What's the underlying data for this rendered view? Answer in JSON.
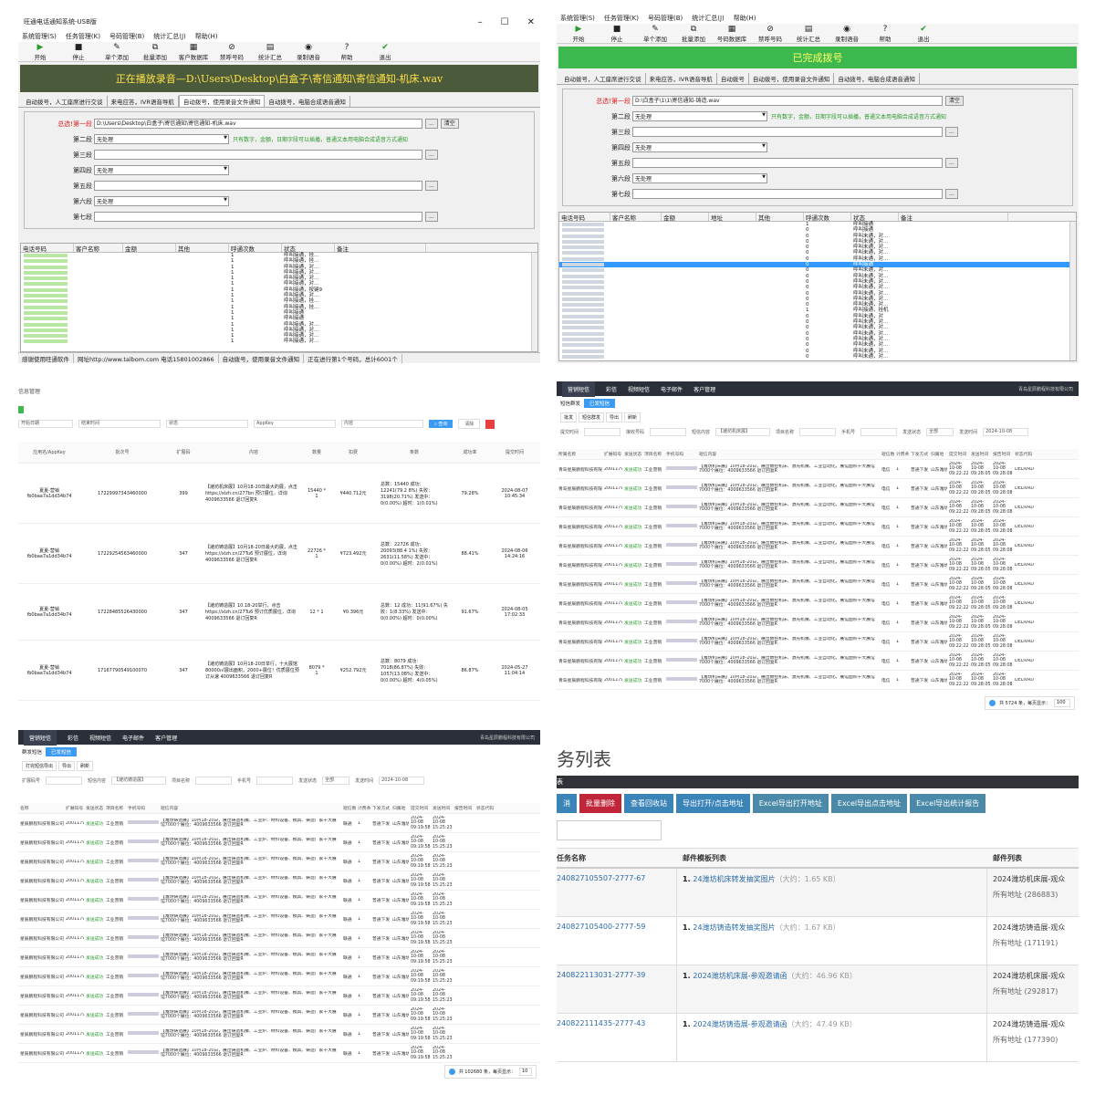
{
  "p1": {
    "title": "旺通电话通知系统-USB版",
    "menu": [
      "系统管理(S)",
      "任务管理(K)",
      "号码管理(B)",
      "统计汇总(J)",
      "帮助(H)"
    ],
    "toolbar": [
      "开始",
      "停止",
      "单个添加",
      "批量添加",
      "客户数据库",
      "禁呼号码",
      "统计汇总",
      "录制语音",
      "帮助",
      "退出"
    ],
    "banner": "正在播放录音—D:\\Users\\Desktop\\白盒子\\寄信通知\\寄信通知-机床.wav",
    "tabs": [
      "自动拨号，人工座席进行交谈",
      "来电应答，IVR语音导航",
      "自动拨号，使用录音文件通知",
      "自动拨号，电脑合成语音通知"
    ],
    "seg1_label": "总选!第一段",
    "seg1_value": "D:\\Users\\Desktop\\白盒子\\寄信通知\\寄信通知-机床.wav",
    "browse": "...",
    "clear": "清空",
    "seg2_label": "第二段",
    "seg3_label": "第三段",
    "seg4_label": "第四段",
    "seg5_label": "第五段",
    "seg6_label": "第六段",
    "seg7_label": "第七段",
    "none": "无处理",
    "hint": "只有数字，金额，日期字段可以插播，普通文本用电脑合成语音方式通知",
    "grid_headers": [
      "电话号码",
      "客户名称",
      "金额",
      "其他",
      "呼通次数",
      "状态",
      "备注"
    ],
    "rows": [
      [
        "1",
        "呼叫接通，挂..."
      ],
      [
        "1",
        "呼叫接通，挂..."
      ],
      [
        "1",
        "呼叫接通，对..."
      ],
      [
        "1",
        "呼叫接通，对..."
      ],
      [
        "1",
        "呼叫接通，对..."
      ],
      [
        "1",
        "呼叫接通，对..."
      ],
      [
        "1",
        "呼叫接通，按键9"
      ],
      [
        "1",
        "呼叫接通，对..."
      ],
      [
        "1",
        "呼叫接通，挂..."
      ],
      [
        "1",
        "呼叫接通，挂..."
      ],
      [
        "1",
        "呼叫接通"
      ],
      [
        "1",
        "呼叫接通"
      ],
      [
        "1",
        "呼叫接通，对..."
      ],
      [
        "1",
        "呼叫接通，对..."
      ],
      [
        "1",
        "呼叫接通，对..."
      ],
      [
        "1",
        "呼叫接通，对..."
      ]
    ],
    "status": [
      "感谢使用旺通软件",
      "网址http://www.talbom.com 电话15801002866",
      "自动拨号，使用录音文件通知",
      "正在进行第1个号码，总计6001个"
    ]
  },
  "p2": {
    "menu": [
      "系统管理(S)",
      "任务管理(K)",
      "号码管理(B)",
      "统计汇总(J)",
      "帮助(H)"
    ],
    "toolbar": [
      "开始",
      "停止",
      "单个添加",
      "批量添加",
      "号码数据库",
      "禁呼号码",
      "统计汇总",
      "录制语音",
      "帮助",
      "退出"
    ],
    "banner": "已完成拨号",
    "tabs": [
      "自动拨号，人工座席进行交谈",
      "来电应答，IVR语音导航",
      "自动拨号",
      "自动拨号，使用录音文件通知",
      "自动拨号，电脑合成语音通知"
    ],
    "seg1_label": "总选!第一段",
    "seg1_value": "D:\\白盒子\\1\\1\\寄信通知-铸造.wav",
    "clear": "清空",
    "seg_labels": [
      "第二段",
      "第三段",
      "第四段",
      "第五段",
      "第六段",
      "第七段"
    ],
    "none": "无处理",
    "hint": "只有数字，金额，日期字段可以插播，普通文本用电脑合成语音方式通知",
    "grid_headers": [
      "电话号码",
      "客户名称",
      "金额",
      "地址",
      "其他",
      "呼通次数",
      "状态",
      "备注"
    ],
    "rows": [
      [
        "1",
        "呼叫接通"
      ],
      [
        "0",
        "呼叫接通"
      ],
      [
        "0",
        "呼叫未通，对..."
      ],
      [
        "0",
        "呼叫未通，对..."
      ],
      [
        "0",
        "呼叫未通，对..."
      ],
      [
        "0",
        "呼叫未通，对..."
      ],
      [
        "0",
        "呼叫未通，对..."
      ],
      [
        "0",
        "呼叫接通"
      ],
      [
        "0",
        "呼叫未通，对..."
      ],
      [
        "0",
        "呼叫未通，对..."
      ],
      [
        "0",
        "呼叫未通，对..."
      ],
      [
        "0",
        "呼叫未通，对..."
      ],
      [
        "0",
        "呼叫未通，对..."
      ],
      [
        "0",
        "呼叫未通，对..."
      ],
      [
        "0",
        "呼叫未通，对..."
      ],
      [
        "1",
        "呼叫接通，挂机"
      ],
      [
        "0",
        "呼叫未通，对"
      ],
      [
        "0",
        "呼叫未通，对..."
      ],
      [
        "0",
        "呼叫未通，对..."
      ],
      [
        "0",
        "呼叫未通，对..."
      ],
      [
        "0",
        "呼叫未通，对..."
      ],
      [
        "0",
        "呼叫未通，对..."
      ],
      [
        "0",
        "呼叫未通，对..."
      ],
      [
        "0",
        "呼叫未通，对..."
      ]
    ],
    "selected_row": 7
  },
  "p3": {
    "header": "信息管理",
    "filters": [
      "开始日期",
      "至",
      "结束时间",
      "状态",
      "AppKey",
      "内容"
    ],
    "search": "查询",
    "reset": "清除",
    "headers": [
      "应用名/AppKey",
      "批次号",
      "扩展码",
      "内容",
      "数量",
      "扣费",
      "条数",
      "成功率",
      "提交时间"
    ],
    "rows": [
      {
        "app": "夏夏-营销",
        "key": "fb0baa7a1dd34b74",
        "batch": "17229997343460000",
        "ext": "399",
        "content": "【潍坊机床展】10月18-20日最大的展，点击 https://xlzh.cn/277bn 预订展位，详询 4009633566 退订回复R",
        "qty": "15440 * 1",
        "fee": "¥440.712元",
        "stats": "总数：15440 成功：12241(79.2 8%) 失败：3198(20.71%) 发送中：0(0.00%) 超时：1(0.01%)",
        "rate": "79.28%",
        "time": "2024-08-07 10:45:34"
      },
      {
        "app": "夏夏-营销",
        "key": "fb0baa7a1dd34b74",
        "batch": "17229254563460000",
        "ext": "347",
        "content": "【潍坊铸造展】10月18-20日最大的展，点击 https://xlzh.cn/27Tu6 预订展位，详询 4009633566 退订回复R",
        "qty": "22726 * 1",
        "fee": "¥723.492元",
        "stats": "总数：22726 成功：20093(88.4 1%) 失败：2631(11.58%) 发送中：0(0.00%) 超时：2(0.01%)",
        "rate": "88.41%",
        "time": "2024-08-06 14:24:16"
      },
      {
        "app": "夏夏-营销",
        "key": "fb0baa7a1dd34b74",
        "batch": "17228485526430000",
        "ext": "347",
        "content": "【潍坊铸造展】10.18-20举行，点击 https://xlzh.cn/27Tu6 预订优质展位，详询 4009633566 退订回复R",
        "qty": "12 * 1",
        "fee": "¥0.396元",
        "stats": "总数：12 成功：11(91.67%) 失败：1(8.33%) 发送中：0(0.00%) 超时：0(0.00%)",
        "rate": "91.67%",
        "time": "2024-08-05 17:02:33"
      },
      {
        "app": "夏夏-营销",
        "key": "fb0baa7a1dd34b74",
        "batch": "17167790549100070",
        "ext": "347",
        "content": "【潍坊铸造展】10月18-20日举行，十大展馆80000㎡展出面积，2000+展位！优质展位预订从速 4009633566 退订回复R",
        "qty": "8079 * 1",
        "fee": "¥252.792元",
        "stats": "总数：8079 成功：7018(86.87%) 失败：1057(13.08%) 发送中：0(0.00%) 超时：4(0.05%)",
        "rate": "86.87%",
        "time": "2024-05-27 11:04:14"
      }
    ]
  },
  "p4": {
    "nav": [
      "营销短信",
      "彩信",
      "视频短信",
      "电子邮件",
      "客户管理"
    ],
    "nav_right": "青岛星辰鹏程科技有限公司",
    "tabs": [
      "短信群发",
      "已发短信"
    ],
    "buttons": [
      "批发",
      "短信群发",
      "导出",
      "刷新"
    ],
    "filters": [
      "提交时间",
      "接收号码",
      "短信内容",
      "项目名称",
      "手机号",
      "发送状态",
      "发送时间"
    ],
    "filter_vals": {
      "content": "【潍坊机床展】",
      "status": "全部",
      "date": "2024-10-08"
    },
    "headers": [
      "所属名称",
      "扩展码号",
      "发送状态",
      "项目名称",
      "手机号码",
      "短信内容",
      "短信数量",
      "计费条数",
      "下发方式",
      "归属地",
      "提交时间",
      "发送时间",
      "报告时间",
      "状态代码"
    ],
    "row": {
      "name": "青岛星辰鹏程科技有限公司",
      "code": "2001179",
      "status": "发送成功",
      "proj": "工业营销",
      "content": "【潍坊机床展】10月18-20日，展出数控机床、激光机械、工业自动化，展馆面积十大展馆7000个展位：4009633566 退订回复R",
      "op": "电信",
      "n": "1",
      "mode": "普通下发",
      "loc": "山东潍坊",
      "submit": "2024-10-08 09:22:22",
      "send": "2024-10-08 09:28:05",
      "report": "2024-10-08 09:28:08",
      "code2": "DELIVRD"
    },
    "row_count": 12,
    "pager": "共 5724 条，每页显示：",
    "page_size": "100"
  },
  "p5": {
    "nav": [
      "营销短信",
      "彩信",
      "视频短信",
      "电子邮件",
      "客户管理"
    ],
    "nav_right": "青岛星辰鹏程科技有限公司",
    "tabs": [
      "群发短信",
      "已发短信"
    ],
    "buttons": [
      "打完短信导出",
      "导出",
      "刷新"
    ],
    "filters": [
      "扩展码号",
      "短信内容",
      "项目名称",
      "手机号",
      "发送状态",
      "发送时间"
    ],
    "filter_vals": {
      "content": "【潍坊铸造展】",
      "status": "全部",
      "date": "2024-10-08"
    },
    "headers": [
      "名称",
      "扩展码号",
      "发送状态",
      "项目名称",
      "手机号码",
      "短信内容",
      "短信数量",
      "计费条数",
      "下发方式",
      "归属地",
      "提交时间",
      "发送时间",
      "报告时间",
      "状态代码"
    ],
    "row": {
      "name": "星辰鹏程科技有限公司",
      "code": "2001179",
      "status": "发送成功",
      "proj": "工业营销",
      "content": "【潍坊铸造展】10月18-20日，展出铸造机械、工业炉、材料设备、模具、铸造厂家十大展馆7000个展位：4009633566 退订回复R",
      "op": "联通",
      "n": "1",
      "mode": "普通下发",
      "loc": "山东潍坊",
      "submit": "2024-10-08 09:19:58",
      "send": "2024-10-08 15:25:23"
    },
    "row_count": 13,
    "pager": "共 102680 条，每页显示：",
    "page_size": "10"
  },
  "p6": {
    "title": "务列表",
    "bar": "表",
    "buttons": [
      "消",
      "批量删除",
      "查看回收站",
      "导出打开/点击地址",
      "Excel导出打开地址",
      "Excel导出点击地址",
      "Excel导出统计报告"
    ],
    "headers": [
      "任务名称",
      "邮件模板列表",
      "邮件列表"
    ],
    "rows": [
      {
        "task": "240827105507-2777-67",
        "tpl": "24潍坊机床转发抽奖图片",
        "size": "（大约：1.65 KB）",
        "list": "2024潍坊机床展-观众",
        "addr": "所有地址 (286883)"
      },
      {
        "task": "240827105400-2777-59",
        "tpl": "24潍坊铸造转发抽奖图片",
        "size": "（大约：1.67 KB）",
        "list": "2024潍坊铸造展-观众",
        "addr": "所有地址 (171191)"
      },
      {
        "task": "240822113031-2777-39",
        "tpl": "2024潍坊机床展-参观邀请函",
        "size": "（大约：46.96 KB）",
        "list": "2024潍坊机床展-观众",
        "addr": "所有地址 (292817)"
      },
      {
        "task": "240822111435-2777-43",
        "tpl": "2024潍坊铸造展-参观邀请函",
        "size": "（大约：47.49 KB）",
        "list": "2024潍坊铸造展-观众",
        "addr": "所有地址 (177390)"
      }
    ]
  }
}
